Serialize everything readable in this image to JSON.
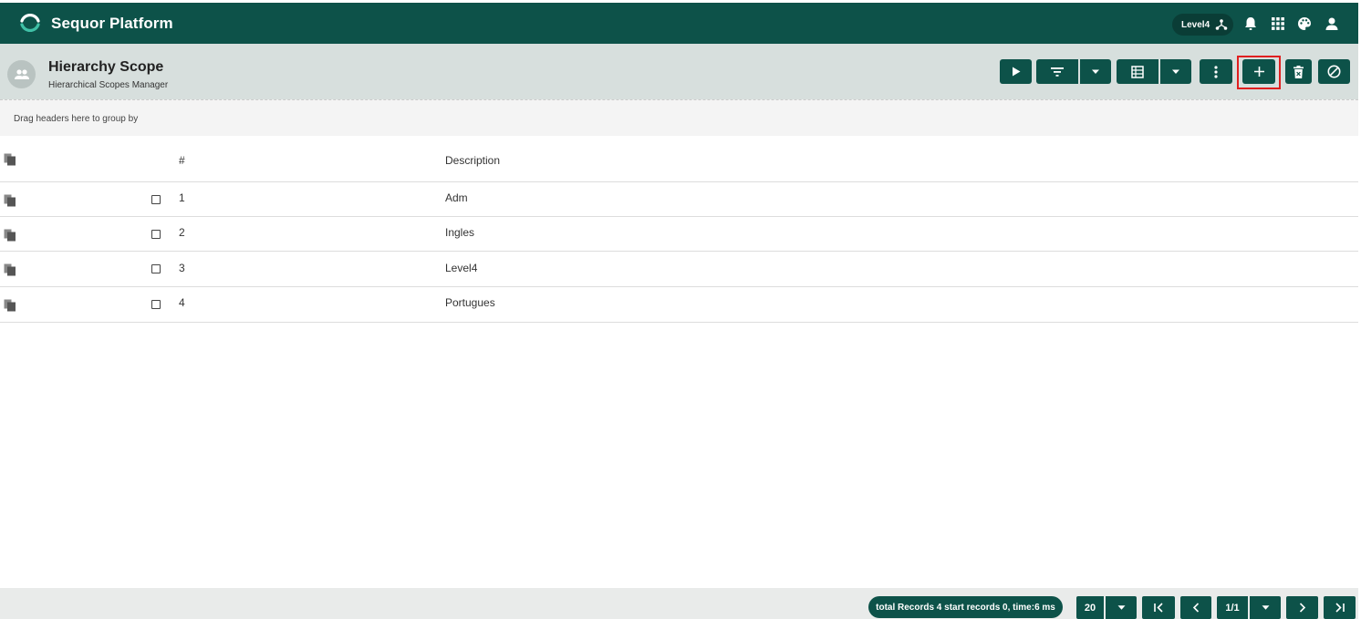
{
  "app": {
    "title": "Sequor Platform",
    "level_label": "Level4"
  },
  "header": {
    "title": "Hierarchy Scope",
    "subtitle": "Hierarchical Scopes Manager"
  },
  "group_bar": {
    "text": "Drag headers here to group by"
  },
  "grid": {
    "columns": [
      "#",
      "Description"
    ],
    "rows": [
      {
        "num": "1",
        "description": "Adm"
      },
      {
        "num": "2",
        "description": "Ingles"
      },
      {
        "num": "3",
        "description": "Level4"
      },
      {
        "num": "4",
        "description": "Portugues"
      }
    ]
  },
  "footer": {
    "stats": "total Records 4 start records 0, time:6 ms",
    "page_size": "20",
    "page": "1/1"
  },
  "colors": {
    "primary": "#0d5249",
    "header_bg": "#d7dfdd",
    "highlight": "#e02020"
  }
}
